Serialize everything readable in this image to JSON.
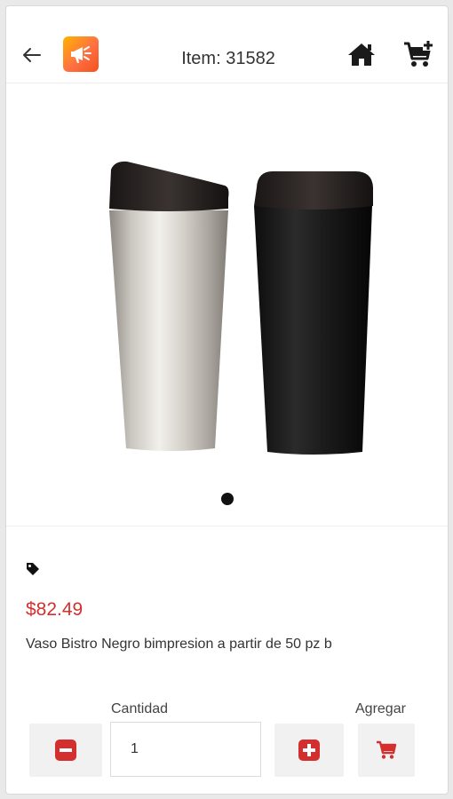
{
  "header": {
    "back_icon": "arrow-left-icon",
    "logo_icon": "megaphone-logo-icon",
    "title": "Item: 31582",
    "home_icon": "home-icon",
    "cart_icon": "cart-plus-icon"
  },
  "product": {
    "image_description_icon": "product-image",
    "tag_icon": "tag-icon",
    "price": "$82.49",
    "description": "Vaso Bistro Negro bimpresion a partir de 50 pz b",
    "carousel_active_index": 1,
    "carousel_total": 1
  },
  "quantity": {
    "label": "Cantidad",
    "value": "1",
    "minus_icon": "minus-icon",
    "plus_icon": "plus-icon"
  },
  "add": {
    "label": "Agregar",
    "icon": "cart-icon"
  },
  "colors": {
    "accent": "#d32f2f",
    "button_bg": "#f1f1f1"
  }
}
